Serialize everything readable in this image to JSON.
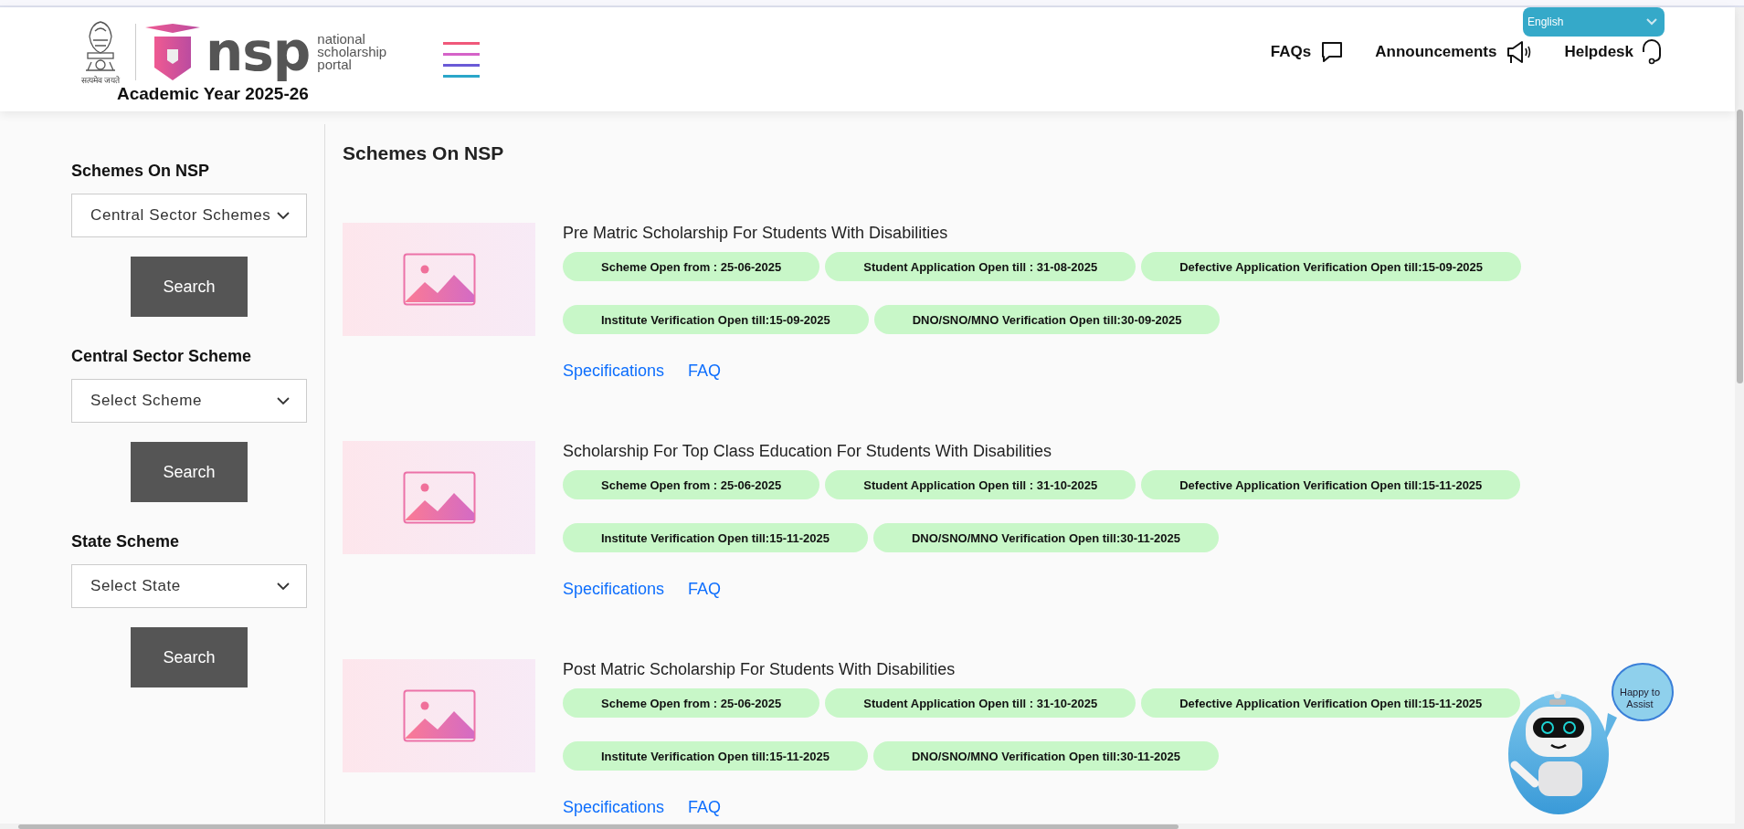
{
  "header": {
    "emblem_motto": "सत्यमेव जयते",
    "logo_mark": "nsp",
    "logo_tagline": [
      "national",
      "scholarship",
      "portal"
    ],
    "academic_year": "Academic Year 2025-26",
    "nav": [
      {
        "label": "FAQs",
        "kind": "chat"
      },
      {
        "label": "Announcements",
        "kind": "megaphone"
      },
      {
        "label": "Helpdesk",
        "kind": "headset"
      }
    ],
    "language": {
      "value": "English"
    }
  },
  "sidebar": {
    "groups": [
      {
        "heading": "Schemes On NSP",
        "select": "Central Sector Schemes",
        "button": "Search"
      },
      {
        "heading": "Central Sector Scheme",
        "select": "Select Scheme",
        "button": "Search"
      },
      {
        "heading": "State Scheme",
        "select": "Select State",
        "button": "Search"
      }
    ]
  },
  "main": {
    "heading": "Schemes On NSP",
    "schemes": [
      {
        "title": "Pre Matric Scholarship For Students With Disabilities",
        "dates": [
          "Scheme Open from : 25-06-2025",
          "Student Application Open till : 31-08-2025",
          "Defective Application Verification Open till:15-09-2025",
          "Institute Verification Open till:15-09-2025",
          "DNO/SNO/MNO Verification Open till:30-09-2025"
        ],
        "links": [
          "Specifications",
          "FAQ"
        ]
      },
      {
        "title": "Scholarship For Top Class Education For Students With Disabilities",
        "dates": [
          "Scheme Open from : 25-06-2025",
          "Student Application Open till : 31-10-2025",
          "Defective Application Verification Open till:15-11-2025",
          "Institute Verification Open till:15-11-2025",
          "DNO/SNO/MNO Verification Open till:30-11-2025"
        ],
        "links": [
          "Specifications",
          "FAQ"
        ]
      },
      {
        "title": "Post Matric Scholarship For Students With Disabilities",
        "dates": [
          "Scheme Open from : 25-06-2025",
          "Student Application Open till : 31-10-2025",
          "Defective Application Verification Open till:15-11-2025",
          "Institute Verification Open till:15-11-2025",
          "DNO/SNO/MNO Verification Open till:30-11-2025"
        ],
        "links": [
          "Specifications",
          "FAQ"
        ]
      }
    ]
  },
  "chatbot": {
    "bubble": "Happy to Assist"
  }
}
